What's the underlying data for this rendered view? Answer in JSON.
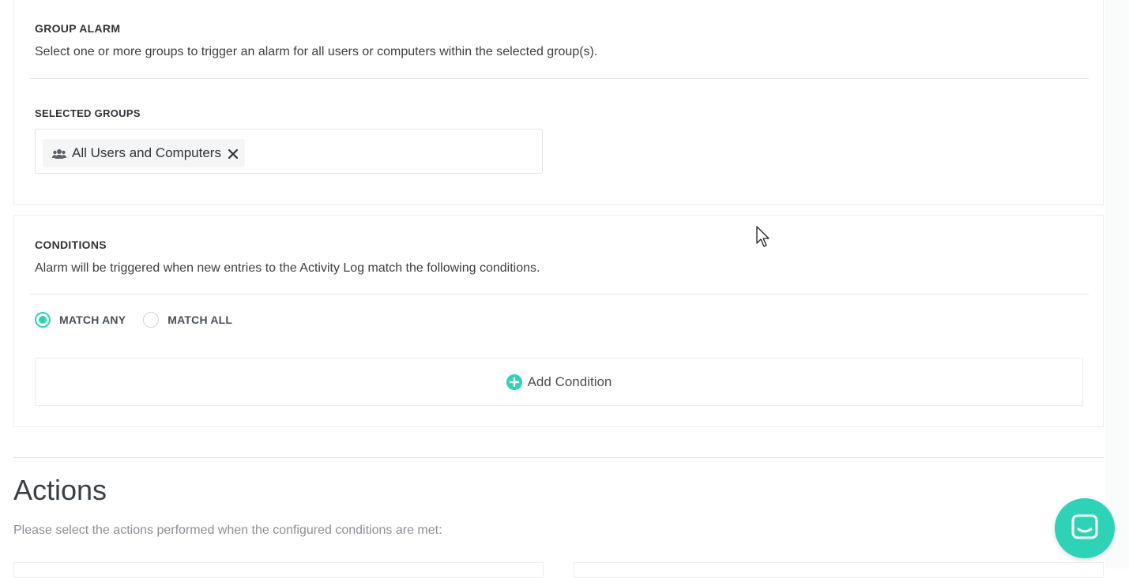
{
  "group_alarm": {
    "title": "GROUP ALARM",
    "description": "Select one or more groups to trigger an alarm for all users or computers within the selected group(s).",
    "selected_groups_label": "SELECTED GROUPS",
    "selected_groups": [
      {
        "label": "All Users and Computers",
        "icon": "users-icon"
      }
    ]
  },
  "conditions": {
    "title": "CONDITIONS",
    "description": "Alarm will be triggered when new entries to the Activity Log match the following conditions.",
    "match_options": [
      {
        "label": "MATCH ANY",
        "checked": true
      },
      {
        "label": "MATCH ALL",
        "checked": false
      }
    ],
    "add_condition_label": "Add Condition"
  },
  "actions": {
    "title": "Actions",
    "description": "Please select the actions performed when the configured conditions are met:"
  },
  "colors": {
    "accent": "#2ed3b7",
    "text": "#2f3337",
    "muted": "#8b9096",
    "border": "#eceef0"
  }
}
